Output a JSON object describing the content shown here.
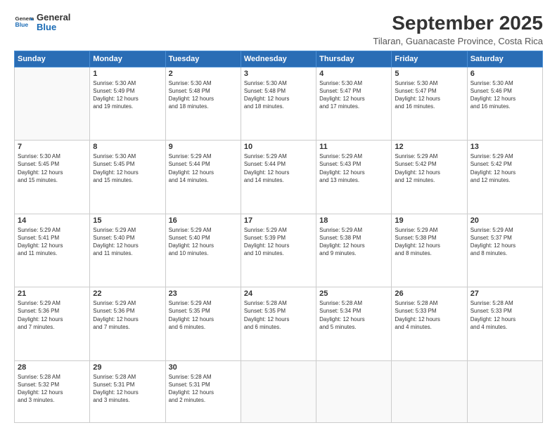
{
  "logo": {
    "line1": "General",
    "line2": "Blue"
  },
  "title": "September 2025",
  "subtitle": "Tilaran, Guanacaste Province, Costa Rica",
  "headers": [
    "Sunday",
    "Monday",
    "Tuesday",
    "Wednesday",
    "Thursday",
    "Friday",
    "Saturday"
  ],
  "weeks": [
    [
      {
        "num": "",
        "info": ""
      },
      {
        "num": "1",
        "info": "Sunrise: 5:30 AM\nSunset: 5:49 PM\nDaylight: 12 hours\nand 19 minutes."
      },
      {
        "num": "2",
        "info": "Sunrise: 5:30 AM\nSunset: 5:48 PM\nDaylight: 12 hours\nand 18 minutes."
      },
      {
        "num": "3",
        "info": "Sunrise: 5:30 AM\nSunset: 5:48 PM\nDaylight: 12 hours\nand 18 minutes."
      },
      {
        "num": "4",
        "info": "Sunrise: 5:30 AM\nSunset: 5:47 PM\nDaylight: 12 hours\nand 17 minutes."
      },
      {
        "num": "5",
        "info": "Sunrise: 5:30 AM\nSunset: 5:47 PM\nDaylight: 12 hours\nand 16 minutes."
      },
      {
        "num": "6",
        "info": "Sunrise: 5:30 AM\nSunset: 5:46 PM\nDaylight: 12 hours\nand 16 minutes."
      }
    ],
    [
      {
        "num": "7",
        "info": "Sunrise: 5:30 AM\nSunset: 5:45 PM\nDaylight: 12 hours\nand 15 minutes."
      },
      {
        "num": "8",
        "info": "Sunrise: 5:30 AM\nSunset: 5:45 PM\nDaylight: 12 hours\nand 15 minutes."
      },
      {
        "num": "9",
        "info": "Sunrise: 5:29 AM\nSunset: 5:44 PM\nDaylight: 12 hours\nand 14 minutes."
      },
      {
        "num": "10",
        "info": "Sunrise: 5:29 AM\nSunset: 5:44 PM\nDaylight: 12 hours\nand 14 minutes."
      },
      {
        "num": "11",
        "info": "Sunrise: 5:29 AM\nSunset: 5:43 PM\nDaylight: 12 hours\nand 13 minutes."
      },
      {
        "num": "12",
        "info": "Sunrise: 5:29 AM\nSunset: 5:42 PM\nDaylight: 12 hours\nand 12 minutes."
      },
      {
        "num": "13",
        "info": "Sunrise: 5:29 AM\nSunset: 5:42 PM\nDaylight: 12 hours\nand 12 minutes."
      }
    ],
    [
      {
        "num": "14",
        "info": "Sunrise: 5:29 AM\nSunset: 5:41 PM\nDaylight: 12 hours\nand 11 minutes."
      },
      {
        "num": "15",
        "info": "Sunrise: 5:29 AM\nSunset: 5:40 PM\nDaylight: 12 hours\nand 11 minutes."
      },
      {
        "num": "16",
        "info": "Sunrise: 5:29 AM\nSunset: 5:40 PM\nDaylight: 12 hours\nand 10 minutes."
      },
      {
        "num": "17",
        "info": "Sunrise: 5:29 AM\nSunset: 5:39 PM\nDaylight: 12 hours\nand 10 minutes."
      },
      {
        "num": "18",
        "info": "Sunrise: 5:29 AM\nSunset: 5:38 PM\nDaylight: 12 hours\nand 9 minutes."
      },
      {
        "num": "19",
        "info": "Sunrise: 5:29 AM\nSunset: 5:38 PM\nDaylight: 12 hours\nand 8 minutes."
      },
      {
        "num": "20",
        "info": "Sunrise: 5:29 AM\nSunset: 5:37 PM\nDaylight: 12 hours\nand 8 minutes."
      }
    ],
    [
      {
        "num": "21",
        "info": "Sunrise: 5:29 AM\nSunset: 5:36 PM\nDaylight: 12 hours\nand 7 minutes."
      },
      {
        "num": "22",
        "info": "Sunrise: 5:29 AM\nSunset: 5:36 PM\nDaylight: 12 hours\nand 7 minutes."
      },
      {
        "num": "23",
        "info": "Sunrise: 5:29 AM\nSunset: 5:35 PM\nDaylight: 12 hours\nand 6 minutes."
      },
      {
        "num": "24",
        "info": "Sunrise: 5:28 AM\nSunset: 5:35 PM\nDaylight: 12 hours\nand 6 minutes."
      },
      {
        "num": "25",
        "info": "Sunrise: 5:28 AM\nSunset: 5:34 PM\nDaylight: 12 hours\nand 5 minutes."
      },
      {
        "num": "26",
        "info": "Sunrise: 5:28 AM\nSunset: 5:33 PM\nDaylight: 12 hours\nand 4 minutes."
      },
      {
        "num": "27",
        "info": "Sunrise: 5:28 AM\nSunset: 5:33 PM\nDaylight: 12 hours\nand 4 minutes."
      }
    ],
    [
      {
        "num": "28",
        "info": "Sunrise: 5:28 AM\nSunset: 5:32 PM\nDaylight: 12 hours\nand 3 minutes."
      },
      {
        "num": "29",
        "info": "Sunrise: 5:28 AM\nSunset: 5:31 PM\nDaylight: 12 hours\nand 3 minutes."
      },
      {
        "num": "30",
        "info": "Sunrise: 5:28 AM\nSunset: 5:31 PM\nDaylight: 12 hours\nand 2 minutes."
      },
      {
        "num": "",
        "info": ""
      },
      {
        "num": "",
        "info": ""
      },
      {
        "num": "",
        "info": ""
      },
      {
        "num": "",
        "info": ""
      }
    ]
  ]
}
